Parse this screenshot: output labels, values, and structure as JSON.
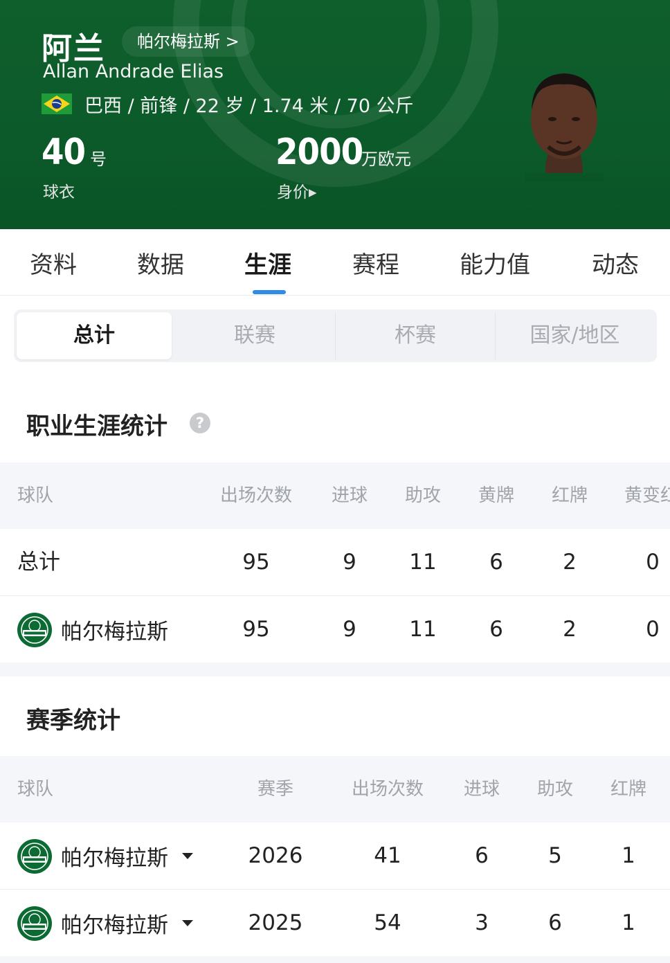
{
  "header": {
    "name_cn": "阿兰",
    "club_link": "帕尔梅拉斯 >",
    "name_en": "Allan Andrade Elias",
    "flag_icon": "brazil-flag-icon",
    "info": "巴西 / 前锋 / 22 岁 / 1.74 米 / 70 公斤",
    "jersey_number": "40",
    "jersey_unit": "号",
    "jersey_label": "球衣",
    "market_value": "2000",
    "market_unit": "万欧元",
    "market_label": "身价▸",
    "colors": {
      "header_bg": "#0c5a2a",
      "accent": "#2f8be6"
    }
  },
  "tabs": [
    {
      "label": "资料"
    },
    {
      "label": "数据"
    },
    {
      "label": "生涯",
      "active": true
    },
    {
      "label": "赛程"
    },
    {
      "label": "能力值"
    },
    {
      "label": "动态"
    }
  ],
  "segment": [
    {
      "label": "总计",
      "active": true
    },
    {
      "label": "联赛"
    },
    {
      "label": "杯赛"
    },
    {
      "label": "国家/地区"
    }
  ],
  "career": {
    "title": "职业生涯统计",
    "help_icon": "question-icon",
    "headers": [
      "球队",
      "出场次数",
      "进球",
      "助攻",
      "黄牌",
      "红牌",
      "黄变红"
    ],
    "rows": [
      {
        "team": "总计",
        "apps": "95",
        "goals": "9",
        "assists": "11",
        "yellow": "6",
        "red": "2",
        "second_yellow": "0"
      },
      {
        "team": "帕尔梅拉斯",
        "logo": "palmeiras-crest-icon",
        "apps": "95",
        "goals": "9",
        "assists": "11",
        "yellow": "6",
        "red": "2",
        "second_yellow": "0"
      }
    ]
  },
  "season": {
    "title": "赛季统计",
    "headers": [
      "球队",
      "赛季",
      "出场次数",
      "进球",
      "助攻",
      "红牌"
    ],
    "rows": [
      {
        "team": "帕尔梅拉斯",
        "logo": "palmeiras-crest-icon",
        "season": "2026",
        "apps": "41",
        "goals": "6",
        "assists": "5",
        "red": "1"
      },
      {
        "team": "帕尔梅拉斯",
        "logo": "palmeiras-crest-icon",
        "season": "2025",
        "apps": "54",
        "goals": "3",
        "assists": "6",
        "red": "1"
      }
    ]
  }
}
